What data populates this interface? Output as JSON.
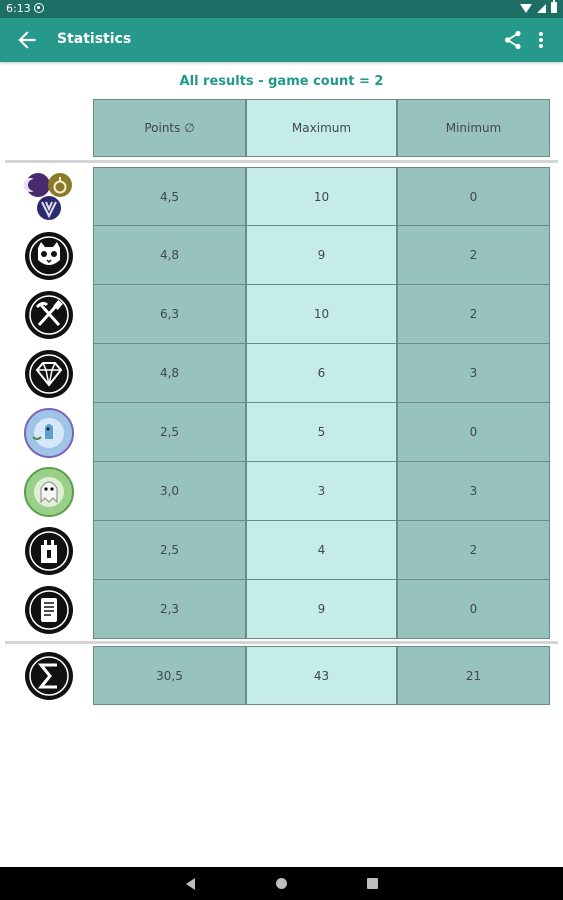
{
  "status_bar": {
    "time": "6:13"
  },
  "app_bar": {
    "title": "Statistics"
  },
  "subtitle": "All results - game count = 2",
  "columns": [
    "Points ∅",
    "Maximum",
    "Minimum"
  ],
  "rows": [
    {
      "icon": "tricolor-symbols-icon",
      "values": [
        "4,5",
        "10",
        "0"
      ]
    },
    {
      "icon": "cat-face-icon",
      "values": [
        "4,8",
        "9",
        "2"
      ]
    },
    {
      "icon": "crossed-tools-icon",
      "values": [
        "6,3",
        "10",
        "2"
      ]
    },
    {
      "icon": "diamond-gem-icon",
      "values": [
        "4,8",
        "6",
        "3"
      ]
    },
    {
      "icon": "blue-bubble-creature-icon",
      "values": [
        "2,5",
        "5",
        "0"
      ]
    },
    {
      "icon": "green-bubble-ghost-icon",
      "values": [
        "3,0",
        "3",
        "3"
      ]
    },
    {
      "icon": "tower-icon",
      "values": [
        "2,5",
        "4",
        "2"
      ]
    },
    {
      "icon": "scroll-icon",
      "values": [
        "2,3",
        "9",
        "0"
      ]
    }
  ],
  "totals": {
    "icon": "sigma-sum-icon",
    "values": [
      "30,5",
      "43",
      "21"
    ]
  },
  "colors": {
    "accent": "#26998a",
    "status_bar": "#1d6e64",
    "cell_dark": "#98c2bd",
    "cell_light": "#c6ece7"
  }
}
